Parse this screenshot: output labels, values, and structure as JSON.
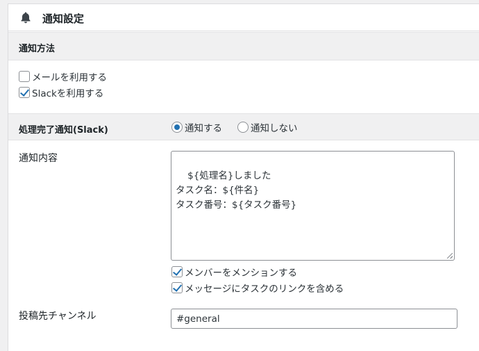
{
  "header": {
    "title": "通知設定",
    "icon": "bell-icon"
  },
  "method_section": {
    "label": "通知方法",
    "options": [
      {
        "label": "メールを利用する",
        "checked": false
      },
      {
        "label": "Slackを利用する",
        "checked": true
      }
    ]
  },
  "completion_section": {
    "label": "処理完了通知(Slack)",
    "radios": [
      {
        "label": "通知する",
        "selected": true
      },
      {
        "label": "通知しない",
        "selected": false
      }
    ]
  },
  "content_field": {
    "label": "通知内容",
    "value": "${処理名}しました\nタスク名：${件名}\nタスク番号：${タスク番号}"
  },
  "content_options": [
    {
      "label": "メンバーをメンションする",
      "checked": true
    },
    {
      "label": "メッセージにタスクのリンクを含める",
      "checked": true
    }
  ],
  "channel_field": {
    "label": "投稿先チャンネル",
    "value": "#general"
  },
  "colors": {
    "accent": "#2271b1",
    "section_bg": "#f0f0f1",
    "border": "#8c8f94"
  }
}
